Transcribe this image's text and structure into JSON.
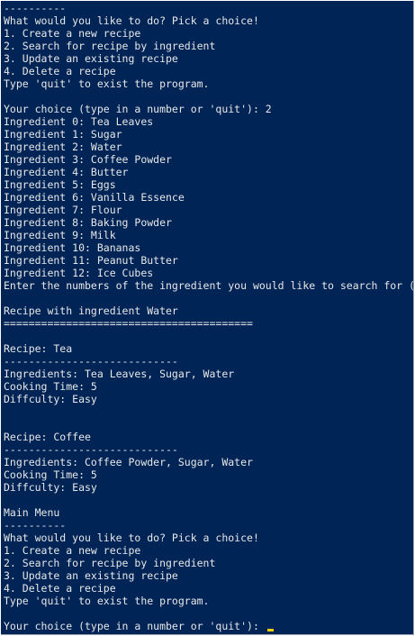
{
  "console": {
    "lines": [
      "----------",
      "What would you like to do? Pick a choice!",
      "1. Create a new recipe",
      "2. Search for recipe by ingredient",
      "3. Update an existing recipe",
      "4. Delete a recipe",
      "Type 'quit' to exist the program.",
      "",
      "Your choice (type in a number or 'quit'): 2",
      "Ingredient 0: Tea Leaves",
      "Ingredient 1: Sugar",
      "Ingredient 2: Water",
      "Ingredient 3: Coffee Powder",
      "Ingredient 4: Butter",
      "Ingredient 5: Eggs",
      "Ingredient 6: Vanilla Essence",
      "Ingredient 7: Flour",
      "Ingredient 8: Baking Powder",
      "Ingredient 9: Milk",
      "Ingredient 10: Bananas",
      "Ingredient 11: Peanut Butter",
      "Ingredient 12: Ice Cubes",
      "Enter the numbers of the ingredient you would like to search for (",
      "",
      "Recipe with ingredient Water",
      "========================================",
      "",
      "Recipe: Tea",
      "----------------------------",
      "Ingredients: Tea Leaves, Sugar, Water",
      "Cooking Time: 5",
      "Diffculty: Easy",
      "",
      "",
      "Recipe: Coffee",
      "----------------------------",
      "Ingredients: Coffee Powder, Sugar, Water",
      "Cooking Time: 5",
      "Diffculty: Easy",
      "",
      "Main Menu",
      "----------",
      "What would you like to do? Pick a choice!",
      "1. Create a new recipe",
      "2. Search for recipe by ingredient",
      "3. Update an existing recipe",
      "4. Delete a recipe",
      "Type 'quit' to exist the program.",
      "",
      "Your choice (type in a number or 'quit'): "
    ],
    "cursor_color": "#f5d000",
    "background_color": "#012456",
    "text_color": "#e8e8e8"
  }
}
